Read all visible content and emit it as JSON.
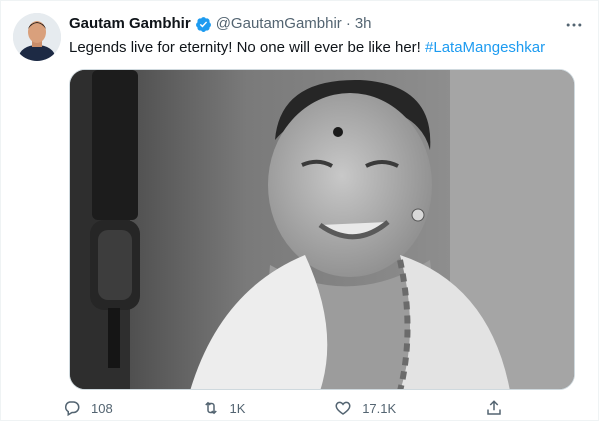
{
  "author": {
    "display_name": "Gautam Gambhir",
    "handle": "@GautamGambhir",
    "separator": "·",
    "timestamp": "3h",
    "verified_icon": "verified-badge-icon"
  },
  "tweet": {
    "text": "Legends live for eternity! No one will ever be like her! ",
    "hashtag": "#LataMangeshkar"
  },
  "actions": {
    "replies": "108",
    "retweets": "1K",
    "likes": "17.1K",
    "share_icon": "share-icon"
  },
  "colors": {
    "accent": "#1d9bf0",
    "secondary_text": "#536471",
    "border": "#cfd9de"
  }
}
